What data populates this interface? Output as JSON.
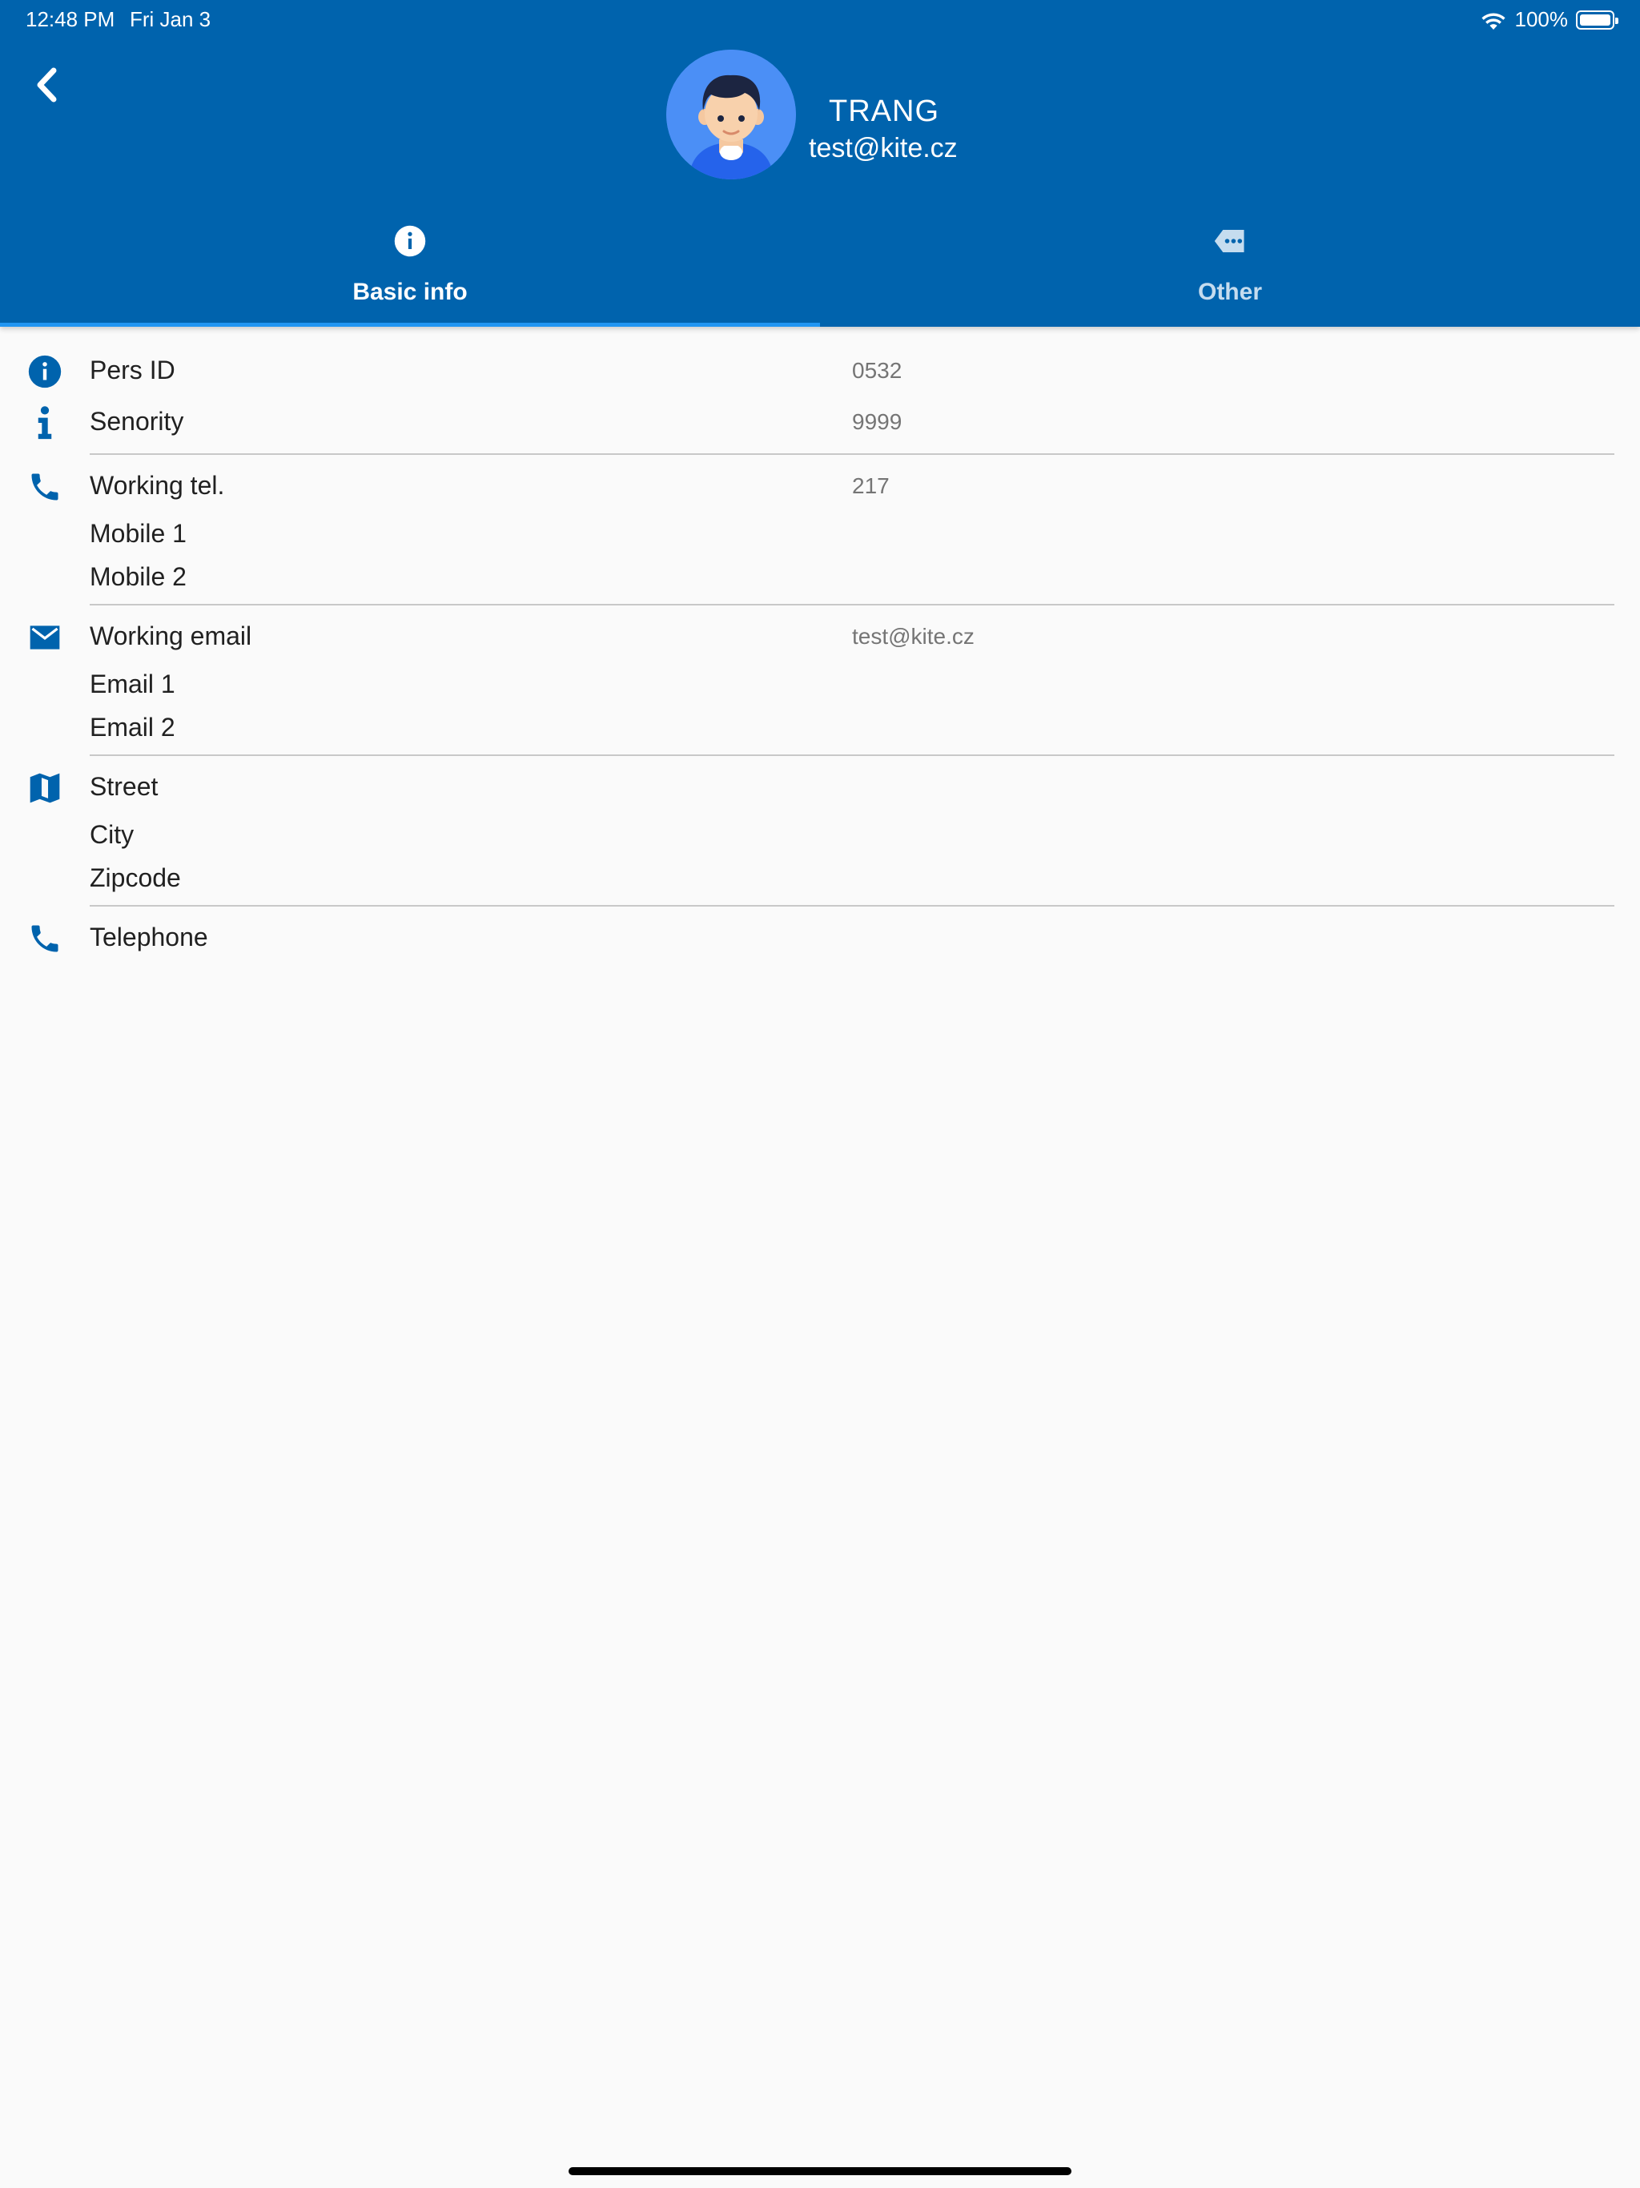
{
  "status_bar": {
    "time": "12:48 PM",
    "date": "Fri Jan 3",
    "battery": "100%"
  },
  "profile": {
    "name": "TRANG",
    "email": "test@kite.cz"
  },
  "tabs": [
    {
      "label": "Basic info",
      "icon": "info-circle-icon",
      "selected": true
    },
    {
      "label": "Other",
      "icon": "more-tag-icon",
      "selected": false
    }
  ],
  "sections": {
    "ids": {
      "pers_id_label": "Pers ID",
      "pers_id_value": "0532",
      "senority_label": "Senority",
      "senority_value": "9999"
    },
    "phones": {
      "working_tel_label": "Working tel.",
      "working_tel_value": "217",
      "mobile1_label": "Mobile 1",
      "mobile2_label": "Mobile 2"
    },
    "emails": {
      "working_email_label": "Working email",
      "working_email_value": "test@kite.cz",
      "email1_label": "Email 1",
      "email2_label": "Email 2"
    },
    "address": {
      "street_label": "Street",
      "city_label": "City",
      "zipcode_label": "Zipcode"
    },
    "contact": {
      "telephone_label": "Telephone"
    }
  },
  "colors": {
    "primary": "#0063ad",
    "tab_indicator": "#2196f3",
    "icon": "#0063ad",
    "background": "#fafafa"
  }
}
